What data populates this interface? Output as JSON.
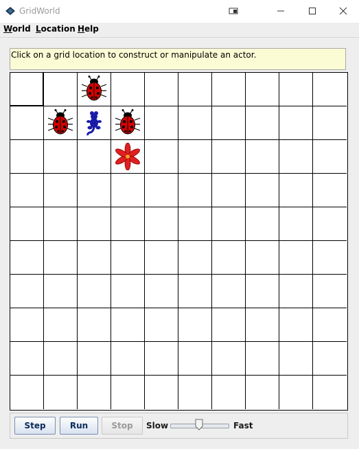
{
  "window": {
    "title": "GridWorld",
    "icons": [
      "gridworld-app-icon",
      "restore-icon",
      "minimize-icon",
      "maximize-icon",
      "close-icon"
    ]
  },
  "menubar": {
    "items": [
      {
        "label_u": "W",
        "label_rest": "orld"
      },
      {
        "label_u": "L",
        "label_rest": "ocation"
      },
      {
        "label_u": "H",
        "label_rest": "elp"
      }
    ]
  },
  "message": "Click on a grid location to construct or manipulate an actor.",
  "grid": {
    "rows": 10,
    "cols": 10,
    "selected": {
      "row": 0,
      "col": 0
    },
    "actors": [
      {
        "type": "bug",
        "row": 0,
        "col": 2,
        "color": "#d40000"
      },
      {
        "type": "bug",
        "row": 1,
        "col": 1,
        "color": "#d40000"
      },
      {
        "type": "critter",
        "row": 1,
        "col": 2,
        "color": "#1a1aa8"
      },
      {
        "type": "bug",
        "row": 1,
        "col": 3,
        "color": "#d40000"
      },
      {
        "type": "flower",
        "row": 2,
        "col": 3,
        "color": "#e02020"
      }
    ]
  },
  "controls": {
    "step": "Step",
    "run": "Run",
    "stop": "Stop",
    "slow": "Slow",
    "fast": "Fast",
    "speed_fraction": 0.5
  },
  "colors": {
    "message_bg": "#fbfbd4",
    "button_text": "#0a2a5a",
    "disabled_text": "#9a9a9a"
  }
}
